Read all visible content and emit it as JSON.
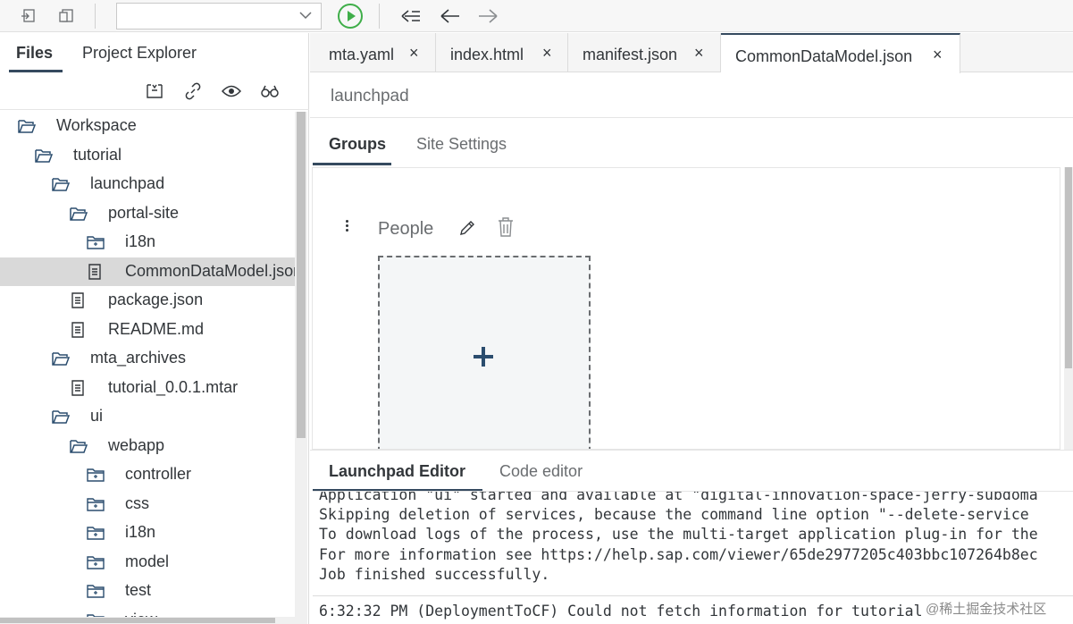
{
  "toolbar": {
    "dropdown_value": "",
    "icons": [
      "undo-icon",
      "redo-icon",
      "chevron-down-icon",
      "run-icon",
      "previous-change-icon",
      "back-icon",
      "forward-icon"
    ]
  },
  "left_panel": {
    "tabs": [
      {
        "label": "Files",
        "active": true
      },
      {
        "label": "Project Explorer",
        "active": false
      }
    ],
    "action_icons": [
      "collapse-all-icon",
      "link-with-editor-icon",
      "show-hidden-icon",
      "search-binoculars-icon"
    ],
    "tree": [
      {
        "label": "Workspace",
        "type": "folder-open",
        "level": 0
      },
      {
        "label": "tutorial",
        "type": "folder-open",
        "level": 1
      },
      {
        "label": "launchpad",
        "type": "folder-open",
        "level": 2
      },
      {
        "label": "portal-site",
        "type": "folder-open",
        "level": 3
      },
      {
        "label": "i18n",
        "type": "folder-closed",
        "level": 4
      },
      {
        "label": "CommonDataModel.json",
        "type": "file",
        "level": 4,
        "selected": true
      },
      {
        "label": "package.json",
        "type": "file",
        "level": 3
      },
      {
        "label": "README.md",
        "type": "file",
        "level": 3
      },
      {
        "label": "mta_archives",
        "type": "folder-open",
        "level": 2
      },
      {
        "label": "tutorial_0.0.1.mtar",
        "type": "file",
        "level": 3
      },
      {
        "label": "ui",
        "type": "folder-open",
        "level": 2
      },
      {
        "label": "webapp",
        "type": "folder-open",
        "level": 3
      },
      {
        "label": "controller",
        "type": "folder-closed",
        "level": 4
      },
      {
        "label": "css",
        "type": "folder-closed",
        "level": 4
      },
      {
        "label": "i18n",
        "type": "folder-closed",
        "level": 4
      },
      {
        "label": "model",
        "type": "folder-closed",
        "level": 4
      },
      {
        "label": "test",
        "type": "folder-closed",
        "level": 4
      },
      {
        "label": "view",
        "type": "folder-closed",
        "level": 4
      }
    ]
  },
  "editor": {
    "tabs": [
      {
        "label": "mta.yaml",
        "close": "×",
        "active": false
      },
      {
        "label": "index.html",
        "close": "×",
        "active": false
      },
      {
        "label": "manifest.json",
        "close": "×",
        "active": false
      },
      {
        "label": "CommonDataModel.json",
        "close": "×",
        "active": true
      }
    ],
    "title": "launchpad",
    "subtabs": [
      {
        "label": "Groups",
        "active": true
      },
      {
        "label": "Site Settings",
        "active": false
      }
    ],
    "group": {
      "title": "People"
    },
    "bottom_tabs": [
      {
        "label": "Launchpad Editor",
        "active": true
      },
      {
        "label": "Code editor",
        "active": false
      }
    ]
  },
  "console": {
    "lines": [
      "Application \"ui\" started and available at \"digital-innovation-space-jerry-subdoma",
      "Skipping deletion of services, because the command line option \"--delete-service",
      "To download logs of the process, use the multi-target application plug-in for the",
      "For more information see https://help.sap.com/viewer/65de2977205c403bbc107264b8ec",
      "Job finished successfully."
    ],
    "last_line": "6:32:32 PM (DeploymentToCF) Could not fetch information for tutorial"
  },
  "watermark": "@稀土掘金技术社区"
}
